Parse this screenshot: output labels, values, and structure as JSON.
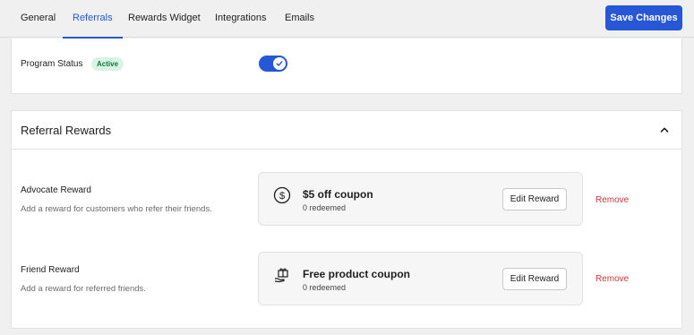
{
  "nav": {
    "tabs": [
      {
        "label": "General"
      },
      {
        "label": "Referrals"
      },
      {
        "label": "Rewards Widget"
      },
      {
        "label": "Integrations"
      },
      {
        "label": "Emails"
      }
    ],
    "active_tab": "Referrals",
    "save_label": "Save Changes"
  },
  "program": {
    "status_label": "Program Status",
    "status_badge": "Active",
    "enabled": true
  },
  "rewards": {
    "title": "Referral Rewards",
    "items": [
      {
        "title": "Advocate Reward",
        "description": "Add a reward for customers who refer their friends.",
        "reward_name": "$5 off coupon",
        "redeemed": "0 redeemed",
        "icon": "dollar-circle-icon",
        "edit_label": "Edit Reward",
        "remove_label": "Remove"
      },
      {
        "title": "Friend Reward",
        "description": "Add a reward for referred friends.",
        "reward_name": "Free product coupon",
        "redeemed": "0 redeemed",
        "icon": "gift-hand-icon",
        "edit_label": "Edit Reward",
        "remove_label": "Remove"
      }
    ]
  },
  "colors": {
    "accent": "#2557d6",
    "danger": "#d63638",
    "badge_bg": "#d8f5e3",
    "badge_text": "#0d7a3b"
  }
}
